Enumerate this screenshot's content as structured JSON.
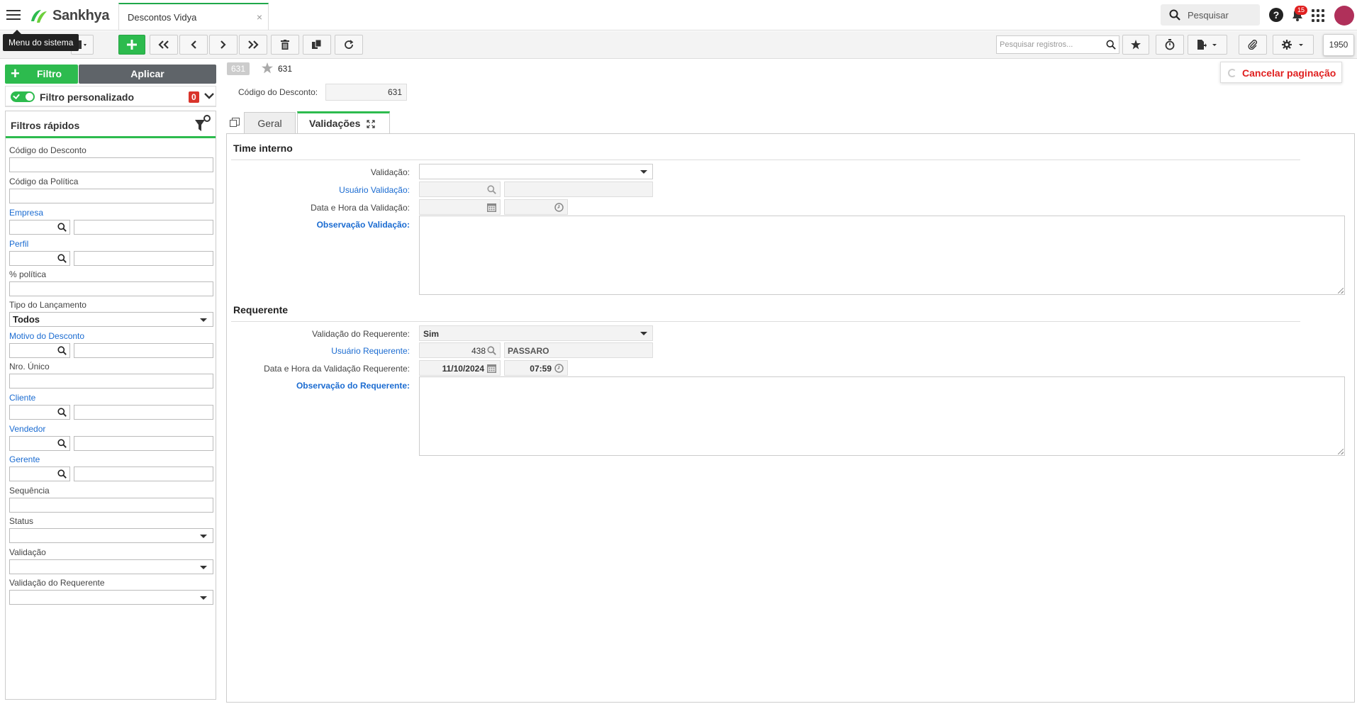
{
  "topbar": {
    "brand": "Sankhya",
    "tab_title": "Descontos Vidya",
    "tab_close": "×",
    "search_placeholder": "Pesquisar",
    "help": "?",
    "notifications_count": "15",
    "menu_tooltip": "Menu do sistema"
  },
  "toolbar": {
    "search_records_placeholder": "Pesquisar registros...",
    "page_size": "1950",
    "cancel_pagination": "Cancelar paginação"
  },
  "filters": {
    "filter_button": "Filtro",
    "apply_button": "Aplicar",
    "custom_filter_label": "Filtro personalizado",
    "custom_filter_count": "0",
    "quick_filters_title": "Filtros rápidos",
    "fields": {
      "codigo_desconto": "Código do Desconto",
      "codigo_politica": "Código da Política",
      "empresa": "Empresa",
      "perfil": "Perfil",
      "perc_politica": "% política",
      "tipo_lancamento": "Tipo do Lançamento",
      "tipo_lancamento_value": "Todos",
      "motivo_desconto": "Motivo do Desconto",
      "nro_unico": "Nro. Único",
      "cliente": "Cliente",
      "vendedor": "Vendedor",
      "gerente": "Gerente",
      "sequencia": "Sequência",
      "status": "Status",
      "validacao": "Validação",
      "validacao_requerente": "Validação do Requerente"
    }
  },
  "record": {
    "badge": "631",
    "number": "631",
    "codigo_label": "Código do Desconto:",
    "codigo_value": "631"
  },
  "tabs": {
    "geral": "Geral",
    "validacoes": "Validações"
  },
  "time_interno": {
    "title": "Time interno",
    "validacao_label": "Validação:",
    "validacao_value": "",
    "usuario_label": "Usuário Validação:",
    "data_hora_label": "Data e Hora da Validação:",
    "observacao_label": "Observação Validação:"
  },
  "requerente": {
    "title": "Requerente",
    "validacao_label": "Validação do Requerente:",
    "validacao_value": "Sim",
    "usuario_label": "Usuário Requerente:",
    "usuario_code": "438",
    "usuario_name": "PASSARO",
    "data_hora_label": "Data e Hora da Validação Requerente:",
    "date_value": "11/10/2024",
    "time_value": "07:59",
    "observacao_label": "Observação do Requerente:"
  }
}
